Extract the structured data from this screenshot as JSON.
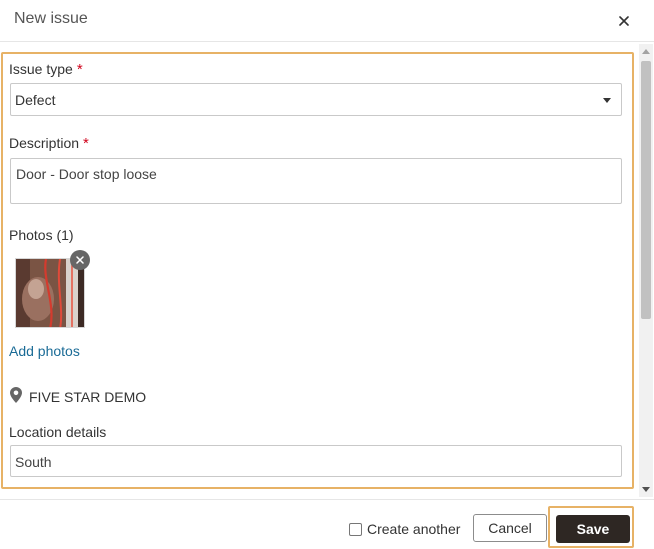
{
  "dialog": {
    "title": "New issue"
  },
  "form": {
    "issue_type": {
      "label": "Issue type",
      "required_mark": "*",
      "value": "Defect"
    },
    "description": {
      "label": "Description",
      "required_mark": "*",
      "value": "Door - Door stop loose"
    },
    "photos": {
      "label": "Photos (1)",
      "add_label": "Add photos"
    },
    "location": {
      "name": "FIVE STAR DEMO",
      "details_label": "Location details",
      "details_value": "South"
    }
  },
  "footer": {
    "create_another_label": "Create another",
    "create_another_checked": false,
    "cancel_label": "Cancel",
    "save_label": "Save"
  },
  "colors": {
    "highlight_border": "#e7b266",
    "required": "#d0021b",
    "link": "#1a6b96",
    "save_button": "#2e2723"
  }
}
